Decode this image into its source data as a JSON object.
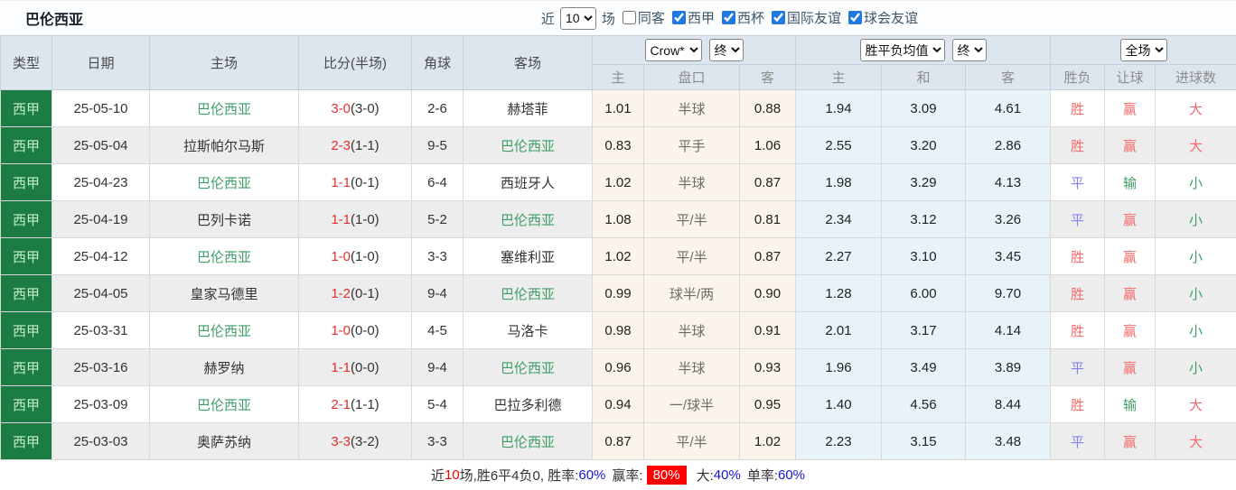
{
  "topbar": {
    "team_title": "巴伦西亚",
    "near_label": "近",
    "recent_count": "10",
    "matches_label": "场",
    "filters": [
      {
        "label": "同客",
        "checked": false
      },
      {
        "label": "西甲",
        "checked": true
      },
      {
        "label": "西杯",
        "checked": true
      },
      {
        "label": "国际友谊",
        "checked": true
      },
      {
        "label": "球会友谊",
        "checked": true
      }
    ]
  },
  "table": {
    "columns": [
      "类型",
      "日期",
      "主场",
      "比分(半场)",
      "角球",
      "客场"
    ],
    "selects": {
      "bookmaker": "Crow*",
      "odds_time": "终",
      "mean_type": "胜平负均值",
      "mean_time": "终",
      "scope": "全场"
    },
    "subheaders": [
      "主",
      "盘口",
      "客",
      "主",
      "和",
      "客",
      "胜负",
      "让球",
      "进球数"
    ],
    "rows": [
      {
        "league": "西甲",
        "date": "25-05-10",
        "home": "巴伦西亚",
        "home_focus": true,
        "score": "3-0",
        "half": "(3-0)",
        "corners": "2-6",
        "away": "赫塔菲",
        "away_focus": false,
        "odds_home": "1.01",
        "handicap": "半球",
        "odds_away": "0.88",
        "mean_home": "1.94",
        "mean_draw": "3.09",
        "mean_away": "4.61",
        "outcome": "胜",
        "outcome_color": "red",
        "let_result": "赢",
        "let_color": "red",
        "goals": "大",
        "goals_color": "red"
      },
      {
        "league": "西甲",
        "date": "25-05-04",
        "home": "拉斯帕尔马斯",
        "home_focus": false,
        "score": "2-3",
        "half": "(1-1)",
        "corners": "9-5",
        "away": "巴伦西亚",
        "away_focus": true,
        "odds_home": "0.83",
        "handicap": "平手",
        "odds_away": "1.06",
        "mean_home": "2.55",
        "mean_draw": "3.20",
        "mean_away": "2.86",
        "outcome": "胜",
        "outcome_color": "red",
        "let_result": "赢",
        "let_color": "red",
        "goals": "大",
        "goals_color": "red"
      },
      {
        "league": "西甲",
        "date": "25-04-23",
        "home": "巴伦西亚",
        "home_focus": true,
        "score": "1-1",
        "half": "(0-1)",
        "corners": "6-4",
        "away": "西班牙人",
        "away_focus": false,
        "odds_home": "1.02",
        "handicap": "半球",
        "odds_away": "0.87",
        "mean_home": "1.98",
        "mean_draw": "3.29",
        "mean_away": "4.13",
        "outcome": "平",
        "outcome_color": "blue",
        "let_result": "输",
        "let_color": "green",
        "goals": "小",
        "goals_color": "green"
      },
      {
        "league": "西甲",
        "date": "25-04-19",
        "home": "巴列卡诺",
        "home_focus": false,
        "score": "1-1",
        "half": "(1-0)",
        "corners": "5-2",
        "away": "巴伦西亚",
        "away_focus": true,
        "odds_home": "1.08",
        "handicap": "平/半",
        "odds_away": "0.81",
        "mean_home": "2.34",
        "mean_draw": "3.12",
        "mean_away": "3.26",
        "outcome": "平",
        "outcome_color": "blue",
        "let_result": "赢",
        "let_color": "red",
        "goals": "小",
        "goals_color": "green"
      },
      {
        "league": "西甲",
        "date": "25-04-12",
        "home": "巴伦西亚",
        "home_focus": true,
        "score": "1-0",
        "half": "(1-0)",
        "corners": "3-3",
        "away": "塞维利亚",
        "away_focus": false,
        "odds_home": "1.02",
        "handicap": "平/半",
        "odds_away": "0.87",
        "mean_home": "2.27",
        "mean_draw": "3.10",
        "mean_away": "3.45",
        "outcome": "胜",
        "outcome_color": "red",
        "let_result": "赢",
        "let_color": "red",
        "goals": "小",
        "goals_color": "green"
      },
      {
        "league": "西甲",
        "date": "25-04-05",
        "home": "皇家马德里",
        "home_focus": false,
        "score": "1-2",
        "half": "(0-1)",
        "corners": "9-4",
        "away": "巴伦西亚",
        "away_focus": true,
        "odds_home": "0.99",
        "handicap": "球半/两",
        "odds_away": "0.90",
        "mean_home": "1.28",
        "mean_draw": "6.00",
        "mean_away": "9.70",
        "outcome": "胜",
        "outcome_color": "red",
        "let_result": "赢",
        "let_color": "red",
        "goals": "小",
        "goals_color": "green"
      },
      {
        "league": "西甲",
        "date": "25-03-31",
        "home": "巴伦西亚",
        "home_focus": true,
        "score": "1-0",
        "half": "(0-0)",
        "corners": "4-5",
        "away": "马洛卡",
        "away_focus": false,
        "odds_home": "0.98",
        "handicap": "半球",
        "odds_away": "0.91",
        "mean_home": "2.01",
        "mean_draw": "3.17",
        "mean_away": "4.14",
        "outcome": "胜",
        "outcome_color": "red",
        "let_result": "赢",
        "let_color": "red",
        "goals": "小",
        "goals_color": "green"
      },
      {
        "league": "西甲",
        "date": "25-03-16",
        "home": "赫罗纳",
        "home_focus": false,
        "score": "1-1",
        "half": "(0-0)",
        "corners": "9-4",
        "away": "巴伦西亚",
        "away_focus": true,
        "odds_home": "0.96",
        "handicap": "半球",
        "odds_away": "0.93",
        "mean_home": "1.96",
        "mean_draw": "3.49",
        "mean_away": "3.89",
        "outcome": "平",
        "outcome_color": "blue",
        "let_result": "赢",
        "let_color": "red",
        "goals": "小",
        "goals_color": "green"
      },
      {
        "league": "西甲",
        "date": "25-03-09",
        "home": "巴伦西亚",
        "home_focus": true,
        "score": "2-1",
        "half": "(1-1)",
        "corners": "5-4",
        "away": "巴拉多利德",
        "away_focus": false,
        "odds_home": "0.94",
        "handicap": "一/球半",
        "odds_away": "0.95",
        "mean_home": "1.40",
        "mean_draw": "4.56",
        "mean_away": "8.44",
        "outcome": "胜",
        "outcome_color": "red",
        "let_result": "输",
        "let_color": "green",
        "goals": "大",
        "goals_color": "red"
      },
      {
        "league": "西甲",
        "date": "25-03-03",
        "home": "奥萨苏纳",
        "home_focus": false,
        "score": "3-3",
        "half": "(3-2)",
        "corners": "3-3",
        "away": "巴伦西亚",
        "away_focus": true,
        "odds_home": "0.87",
        "handicap": "平/半",
        "odds_away": "1.02",
        "mean_home": "2.23",
        "mean_draw": "3.15",
        "mean_away": "3.48",
        "outcome": "平",
        "outcome_color": "blue",
        "let_result": "赢",
        "let_color": "red",
        "goals": "大",
        "goals_color": "red"
      }
    ]
  },
  "footer": {
    "prefix": "近",
    "count": "10",
    "mid": "场,胜6平4负0, 胜率:",
    "win_rate": "60%",
    "yield_label": "赢率:",
    "yield_rate": "80%",
    "big_label": "大:",
    "big_rate": "40%",
    "single_label": "单率:",
    "single_rate": "60%"
  }
}
